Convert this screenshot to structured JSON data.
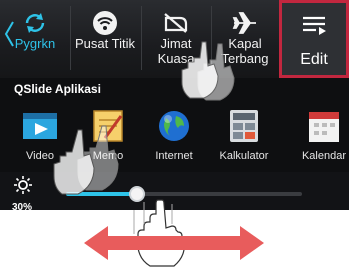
{
  "quick_settings": {
    "tiles": [
      {
        "icon": "sync-icon",
        "label": "Pygrkn"
      },
      {
        "icon": "wifi-hotspot-icon",
        "label": "Pusat Titik"
      },
      {
        "icon": "silent-mode-icon",
        "label": "Jimat Kuasa"
      },
      {
        "icon": "airplane-icon",
        "label": "Kapal Terbang"
      }
    ],
    "edit_label": "Edit"
  },
  "qslide": {
    "title": "QSlide Aplikasi",
    "apps": [
      {
        "icon": "video-icon",
        "label": "Video"
      },
      {
        "icon": "memo-icon",
        "label": "Memo"
      },
      {
        "icon": "internet-globe-icon",
        "label": "Internet"
      },
      {
        "icon": "calculator-icon",
        "label": "Kalkulator"
      },
      {
        "icon": "calendar-icon",
        "label": "Kalendar"
      }
    ]
  },
  "brightness": {
    "value_label": "30%",
    "level": 0.3
  },
  "colors": {
    "accent": "#2ec3e8",
    "edit_border": "#c2273f",
    "arrow": "#e85c5c"
  }
}
